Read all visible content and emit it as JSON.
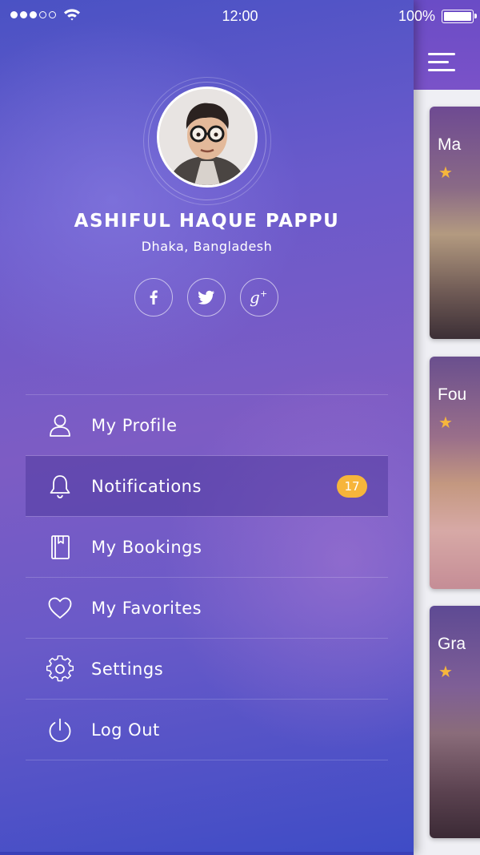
{
  "status_bar": {
    "time": "12:00",
    "battery": "100%",
    "signal_dots_on": 3,
    "signal_dots_total": 5
  },
  "profile": {
    "name": "ASHIFUL HAQUE PAPPU",
    "location": "Dhaka, Bangladesh",
    "social": [
      {
        "icon": "facebook-icon",
        "glyph": "f"
      },
      {
        "icon": "twitter-icon",
        "glyph": "bird"
      },
      {
        "icon": "google-plus-icon",
        "glyph": "g+"
      }
    ]
  },
  "menu": {
    "items": [
      {
        "label": "My Profile",
        "icon": "user-icon"
      },
      {
        "label": "Notifications",
        "icon": "bell-icon",
        "badge": "17",
        "active": true
      },
      {
        "label": "My Bookings",
        "icon": "book-icon"
      },
      {
        "label": "My Favorites",
        "icon": "heart-icon"
      },
      {
        "label": "Settings",
        "icon": "gear-icon"
      },
      {
        "label": "Log Out",
        "icon": "power-icon"
      }
    ]
  },
  "content": {
    "cards": [
      {
        "title": "Ma"
      },
      {
        "title": "Fou"
      },
      {
        "title": "Gra"
      }
    ],
    "star_glyph": "★"
  },
  "colors": {
    "badge": "#f7b53b",
    "star": "#f6b63c",
    "drawer_top": "#4a52c4",
    "drawer_mid": "#7d5cc4"
  }
}
